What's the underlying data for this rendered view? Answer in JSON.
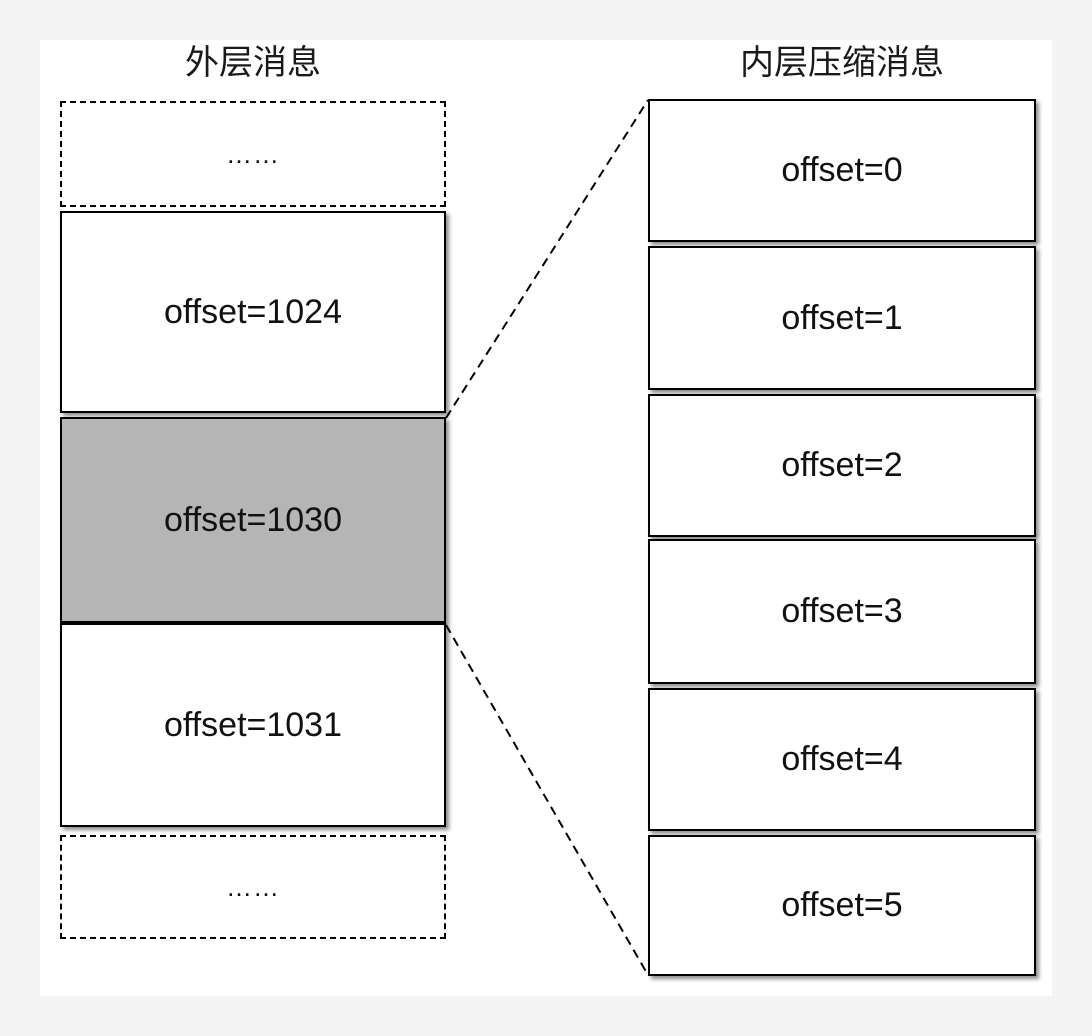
{
  "outer": {
    "title": "外层消息",
    "blocks": [
      {
        "label": "……",
        "style": "dashed"
      },
      {
        "label": "offset=1024",
        "style": "normal"
      },
      {
        "label": "offset=1030",
        "style": "highlight"
      },
      {
        "label": "offset=1031",
        "style": "normal"
      },
      {
        "label": "……",
        "style": "dashed"
      }
    ]
  },
  "inner": {
    "title": "内层压缩消息",
    "blocks": [
      {
        "label": "offset=0"
      },
      {
        "label": "offset=1"
      },
      {
        "label": "offset=2"
      },
      {
        "label": "offset=3"
      },
      {
        "label": "offset=4"
      },
      {
        "label": "offset=5"
      }
    ]
  },
  "colors": {
    "highlight": "#b5b5b5",
    "border": "#000000"
  }
}
